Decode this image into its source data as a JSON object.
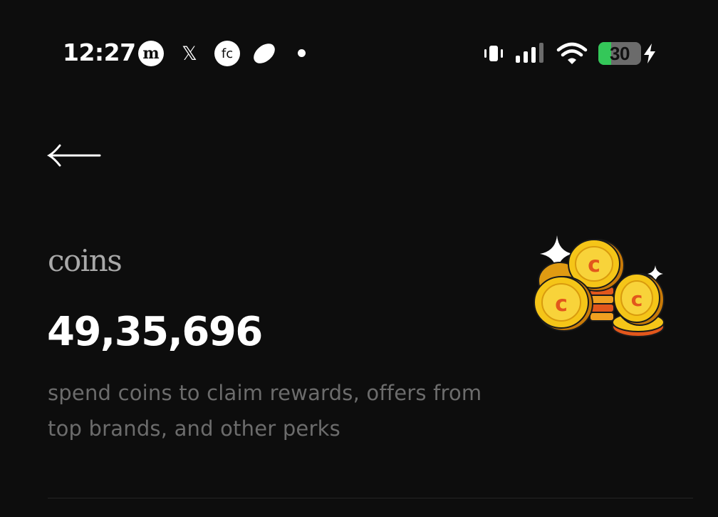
{
  "status_bar": {
    "time": "12:27",
    "battery_level": 30,
    "battery_label": "30",
    "charging": true,
    "notification_icons": [
      "m-app-icon",
      "x-icon",
      "fc-app-icon",
      "leaf-icon",
      "more-dot-icon"
    ],
    "system_icons": [
      "vibrate-icon",
      "signal-icon",
      "wifi-icon",
      "battery-icon",
      "charging-bolt-icon"
    ],
    "notif_m_text": "m",
    "notif_x_text": "𝕏",
    "notif_fc_text": "fc"
  },
  "header": {
    "back_icon": "arrow-left-icon"
  },
  "coins": {
    "label": "coins",
    "balance": "49,35,696",
    "description": "spend coins to claim rewards, offers from top brands, and other perks",
    "illustration": "coin-pile-icon"
  },
  "colors": {
    "background": "#0d0d0d",
    "primary_text": "#ffffff",
    "label_text": "#a9a9a9",
    "muted_text": "#6c6c6c",
    "coin_gold": "#f5c518",
    "coin_accent": "#e2571c",
    "battery_green": "#34c759"
  }
}
